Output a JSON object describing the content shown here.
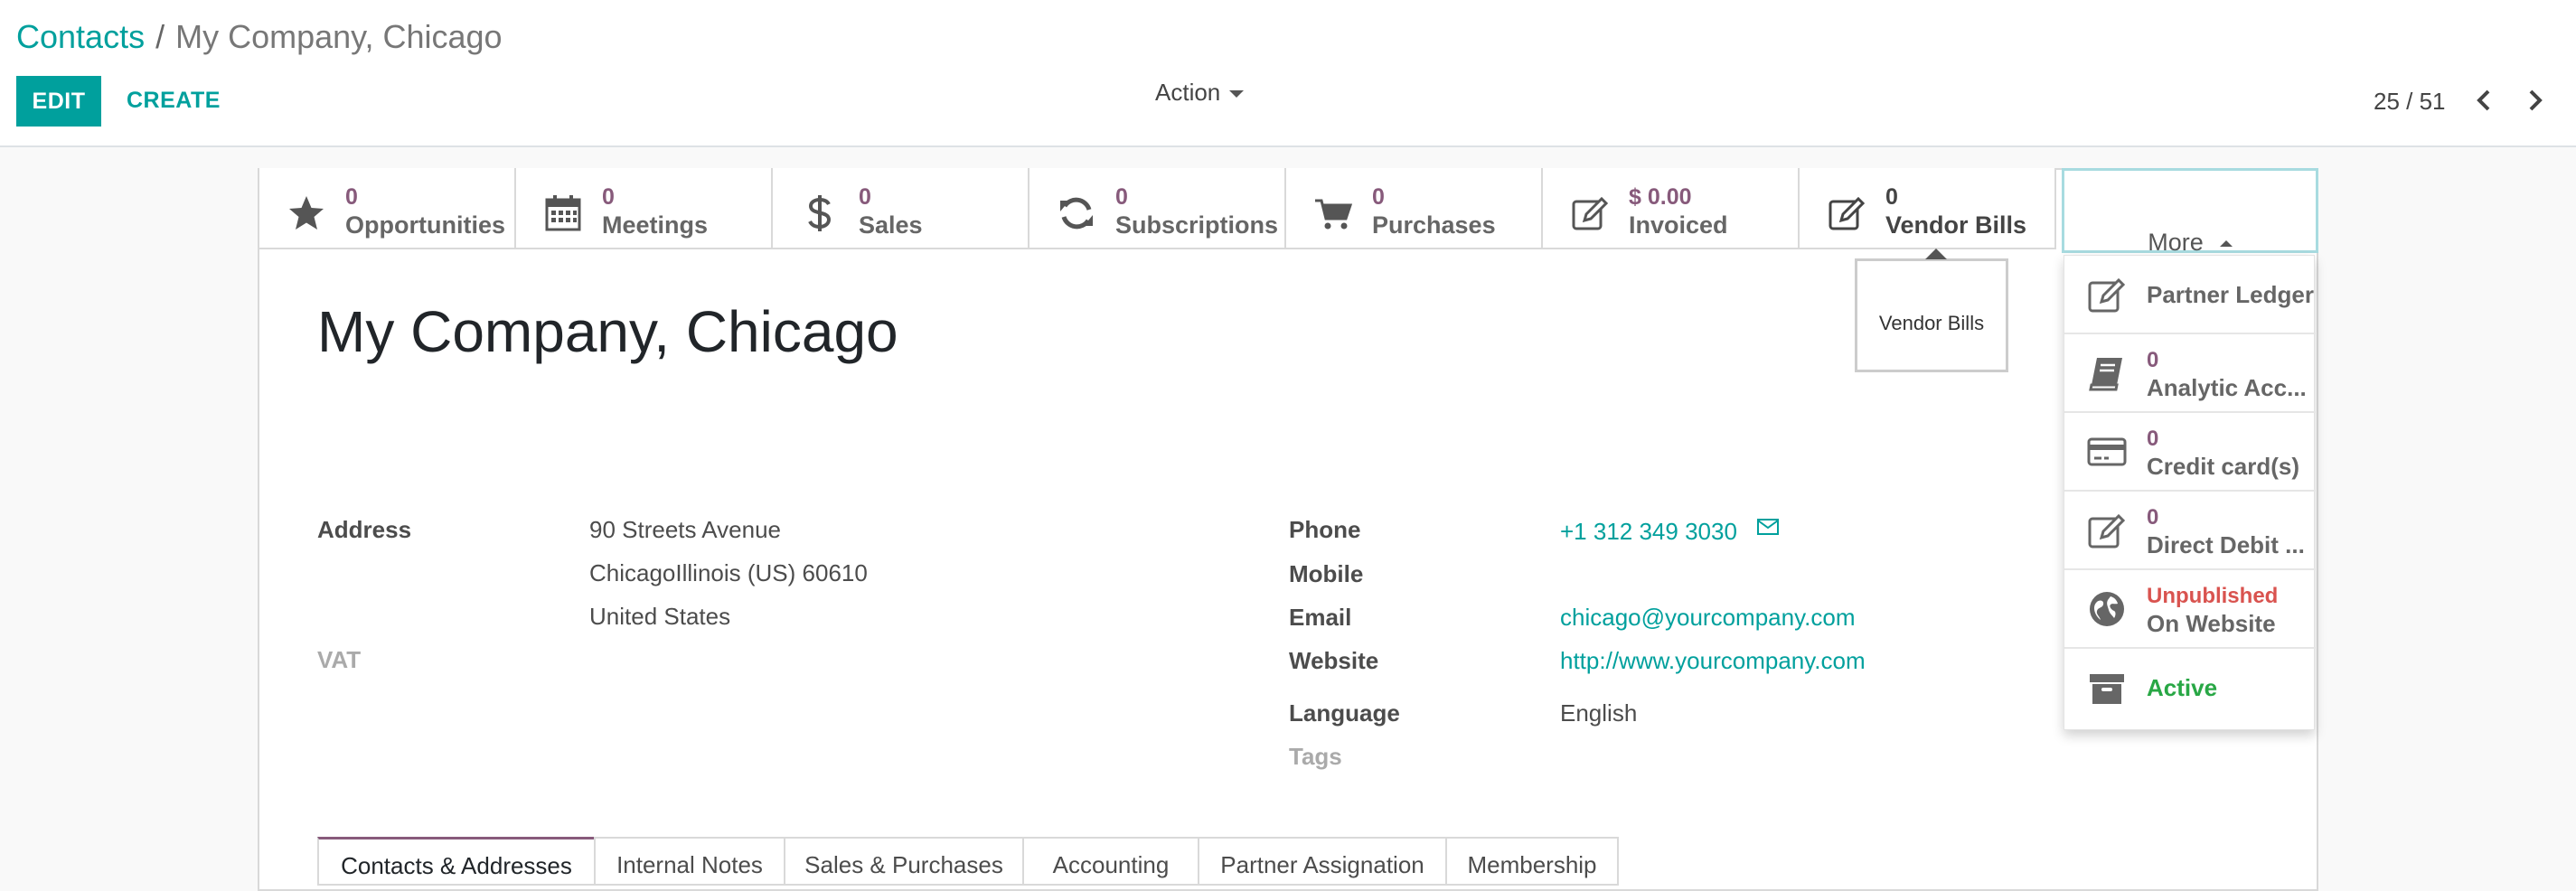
{
  "breadcrumb": {
    "parent": "Contacts",
    "separator": "/",
    "current": "My Company, Chicago"
  },
  "toolbar": {
    "edit_label": "EDIT",
    "create_label": "CREATE",
    "action_label": "Action"
  },
  "pager": {
    "text": "25 / 51"
  },
  "stat_buttons": [
    {
      "icon": "star-icon",
      "value": "0",
      "label": "Opportunities"
    },
    {
      "icon": "calendar-icon",
      "value": "0",
      "label": "Meetings"
    },
    {
      "icon": "dollar-icon",
      "value": "0",
      "label": "Sales"
    },
    {
      "icon": "refresh-icon",
      "value": "0",
      "label": "Subscriptions"
    },
    {
      "icon": "shopping-cart-icon",
      "value": "0",
      "label": "Purchases"
    },
    {
      "icon": "edit-icon",
      "value": "$ 0.00",
      "label": "Invoiced"
    },
    {
      "icon": "edit-icon",
      "value": "0",
      "label": "Vendor Bills"
    }
  ],
  "more": {
    "label": "More"
  },
  "tooltip": {
    "text": "Vendor Bills"
  },
  "more_items": [
    {
      "icon": "edit-icon",
      "value": "",
      "label": "Partner Ledger"
    },
    {
      "icon": "book-icon",
      "value": "0",
      "label": "Analytic Acc..."
    },
    {
      "icon": "credit-card-icon",
      "value": "0",
      "label": "Credit card(s)"
    },
    {
      "icon": "edit-icon",
      "value": "0",
      "label": "Direct Debit ..."
    },
    {
      "icon": "globe-icon",
      "value": "Unpublished",
      "label": "On Website"
    },
    {
      "icon": "archive-icon",
      "value": "",
      "label": "Active"
    }
  ],
  "record": {
    "name": "My Company, Chicago"
  },
  "fields": {
    "address_label": "Address",
    "address_street": "90 Streets Avenue",
    "address_city": "ChicagoIllinois (US)  60610",
    "address_country": "United States",
    "vat_label": "VAT",
    "phone_label": "Phone",
    "phone_value": "+1 312 349 3030",
    "mobile_label": "Mobile",
    "email_label": "Email",
    "email_value": "chicago@yourcompany.com",
    "website_label": "Website",
    "website_value": "http://www.yourcompany.com",
    "language_label": "Language",
    "language_value": "English",
    "tags_label": "Tags"
  },
  "tabs": [
    "Contacts & Addresses",
    "Internal Notes",
    "Sales & Purchases",
    "Accounting",
    "Partner Assignation",
    "Membership"
  ],
  "colors": {
    "accent": "#00a09d",
    "brand": "#875a7b",
    "unpublished": "#d9534f",
    "active": "#28a745"
  }
}
